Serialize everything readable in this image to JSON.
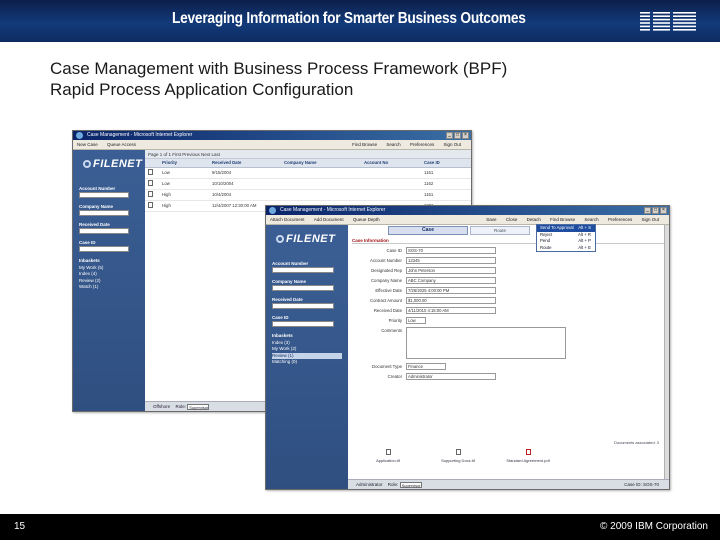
{
  "banner": {
    "title": "Leveraging Information for Smarter Business Outcomes",
    "logo": "IBM"
  },
  "slide": {
    "title_line1": "Case Management with Business Process Framework (BPF)",
    "title_line2": "Rapid Process Application Configuration"
  },
  "footer": {
    "page_number": "15",
    "copyright": "© 2009 IBM Corporation"
  },
  "colors": {
    "banner": "#123a7a",
    "sidebar": "#2f4f80",
    "footer": "#000000"
  },
  "back_window": {
    "title": "Case Management - Microsoft Internet Explorer",
    "toolbar": [
      "New Case",
      "Queue Access"
    ],
    "toolbar_right": [
      "Find Browse",
      "Search",
      "Preferences",
      "Sign Out"
    ],
    "logo_text": "FILENET",
    "fields": [
      "Account Number",
      "Company Name",
      "Received Date",
      "Case ID"
    ],
    "inbasket_heading": "Inbaskets",
    "inbaskets": [
      "My Work (5)",
      "Index (4)",
      "Review (2)",
      "Watch (1)"
    ],
    "pager": "Page 1 of 1   First Previous Next Last",
    "columns": [
      "",
      "Priority",
      "Received Date",
      "Company Name",
      "Account No",
      "Case ID"
    ],
    "rows": [
      [
        "",
        "Low",
        "9/15/2004",
        "",
        "",
        "1161"
      ],
      [
        "",
        "Low",
        "10/10/2004",
        "",
        "",
        "1162"
      ],
      [
        "",
        "High",
        "10/4/2004",
        "",
        "",
        "1161"
      ],
      [
        "",
        "High",
        "12/4/2007 12:30:00 AM",
        "",
        "",
        "1201"
      ]
    ],
    "bottom_label": "Offshore",
    "bottom_role_label": "Role:",
    "bottom_role_value": "Supervisor"
  },
  "front_window": {
    "title": "Case Management - Microsoft Internet Explorer",
    "toolbar": [
      "Attach Document",
      "Add Document",
      "Queue Depth"
    ],
    "toolbar_right": [
      "Save",
      "Close",
      "Detach",
      "Find Browse",
      "Search",
      "Preferences",
      "Sign Out"
    ],
    "logo_text": "FILENET",
    "fields": [
      "Account Number",
      "Company Name",
      "Received Date",
      "Case ID"
    ],
    "inbasket_heading": "Inbaskets",
    "inbaskets": [
      "Index (3)",
      "My Work (2)",
      "Review (1)",
      "Matching (0)"
    ],
    "tab_case": "Case",
    "tab_other": "Route",
    "section_heading": "Case Information",
    "form": [
      {
        "label": "Case ID",
        "value": "SOS-70"
      },
      {
        "label": "Account Number",
        "value": "12345"
      },
      {
        "label": "Designated Rep",
        "value": "John Peterson"
      },
      {
        "label": "Company Name",
        "value": "ABC Company"
      },
      {
        "label": "Effective Date",
        "value": "7/26/2025 4:00:00 PM"
      },
      {
        "label": "Contract Amount",
        "value": "$1,000.00"
      },
      {
        "label": "Received Date",
        "value": "4/11/2010 4:15:00 AM"
      },
      {
        "label": "Priority",
        "value": "Low"
      }
    ],
    "comments_label": "Comments",
    "doc_type_label": "Document Type",
    "doc_type_value": "Finance",
    "creator_label": "Creator",
    "creator_value": "Administrator",
    "attachments": [
      "Application.tif",
      "Supporting Docs.tif",
      "Standard Agreement.pdf"
    ],
    "attach_note": "Documents associated: 3",
    "dropdown": [
      {
        "label": "Send To Approval",
        "shortcut": "Alt + S",
        "selected": true
      },
      {
        "label": "Reject",
        "shortcut": "Alt + R",
        "selected": false
      },
      {
        "label": "Pend",
        "shortcut": "Alt + P",
        "selected": false
      },
      {
        "label": "Route",
        "shortcut": "Alt + E",
        "selected": false
      }
    ],
    "bottom_user": "Administrator",
    "bottom_role_label": "Role:",
    "bottom_role_value": "Supervisor",
    "bottom_case_id": "Case ID: SOS-70"
  }
}
